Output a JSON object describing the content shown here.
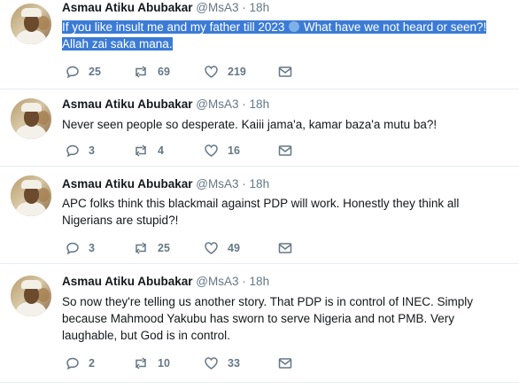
{
  "tweets": [
    {
      "name": "",
      "handle": "@MsA3",
      "dot": "·",
      "time": "18h",
      "text_highlighted": true,
      "text_parts": [
        "If you like insult me and my father till 2023",
        "  What have we not heard or seen?!",
        "Allah zai saka mana."
      ],
      "replies": "25",
      "retweets": "69",
      "likes": "219"
    },
    {
      "name": "Asmau Atiku Abubakar",
      "handle": "@MsA3",
      "dot": "·",
      "time": "18h",
      "text": "Never seen people so desperate. Kaiii jama'a, kamar baza'a mutu ba?!",
      "replies": "3",
      "retweets": "4",
      "likes": "16"
    },
    {
      "name": "Asmau Atiku Abubakar",
      "handle": "@MsA3",
      "dot": "·",
      "time": "18h",
      "text": "APC folks think this blackmail against PDP will work. Honestly they think all Nigerians are stupid?!",
      "replies": "3",
      "retweets": "25",
      "likes": "49"
    },
    {
      "name": "Asmau Atiku Abubakar",
      "handle": "@MsA3",
      "dot": "·",
      "time": "18h",
      "text": "So now they're telling us another story. That PDP is in control of INEC. Simply because Mahmood Yakubu has sworn to serve Nigeria and not PMB. Very laughable, but God is in control.",
      "replies": "2",
      "retweets": "10",
      "likes": "33"
    }
  ],
  "first_tweet_name_visible": "Asmau Atiku Abubakar",
  "icons": {
    "reply": "reply-icon",
    "retweet": "retweet-icon",
    "like": "heart-icon",
    "dm": "envelope-icon"
  },
  "colors": {
    "selection": "#3b7bd6",
    "secondary_text": "#657786",
    "divider": "#e6ecf0"
  }
}
